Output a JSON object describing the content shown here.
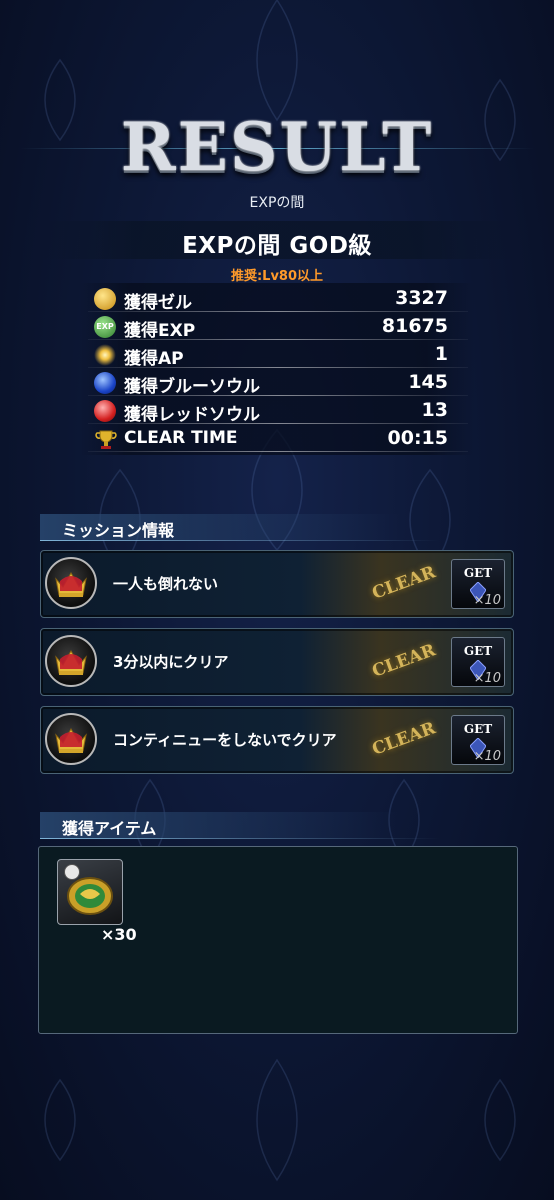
{
  "header": {
    "title": "RESULT",
    "stage_category": "EXPの間",
    "stage_name": "EXPの間 GOD級",
    "recommendation": "推奨:Lv80以上"
  },
  "rewards": [
    {
      "icon": "gold-coin-icon",
      "label": "獲得ゼル",
      "value": "3327",
      "color": "#d8a321"
    },
    {
      "icon": "exp-icon",
      "label": "獲得EXP",
      "value": "81675",
      "color": "#3e9b3c"
    },
    {
      "icon": "ap-star-icon",
      "label": "獲得AP",
      "value": "1",
      "color": "#f0c040"
    },
    {
      "icon": "blue-soul-icon",
      "label": "獲得ブルーソウル",
      "value": "145",
      "color": "#2c62e0"
    },
    {
      "icon": "red-soul-icon",
      "label": "獲得レッドソウル",
      "value": "13",
      "color": "#d42828"
    },
    {
      "icon": "trophy-icon",
      "label": "CLEAR TIME",
      "value": "00:15",
      "color": "#c9a024"
    }
  ],
  "missions_section": {
    "title": "ミッション情報"
  },
  "missions": [
    {
      "text": "一人も倒れない",
      "status": "CLEAR",
      "get_label": "GET",
      "reward_count": "×10"
    },
    {
      "text": "3分以内にクリア",
      "status": "CLEAR",
      "get_label": "GET",
      "reward_count": "×10"
    },
    {
      "text": "コンティニューをしないでクリア",
      "status": "CLEAR",
      "get_label": "GET",
      "reward_count": "×10"
    }
  ],
  "items_section": {
    "title": "獲得アイテム"
  },
  "items": [
    {
      "icon": "gold-medal-item-icon",
      "count": "×30"
    }
  ]
}
